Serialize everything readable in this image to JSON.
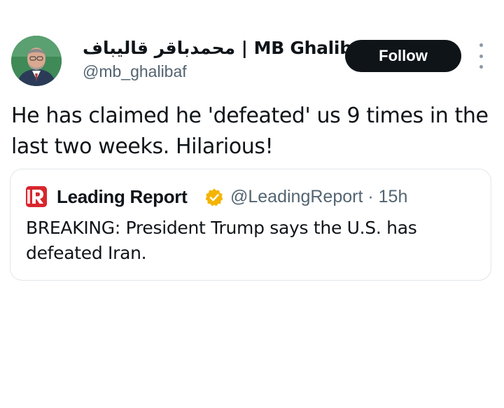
{
  "tweet": {
    "author": {
      "display_name": "محمدباقر قالیباف | MB Ghalib...",
      "handle": "@mb_ghalibaf"
    },
    "follow_label": "Follow",
    "text": "He has claimed he 'defeated' us 9 times in the last two weeks. Hilarious!"
  },
  "quoted_tweet": {
    "author_name": "Leading Report",
    "handle": "@LeadingReport",
    "separator": "·",
    "time": "15h",
    "verified_badge_color": "#f4b400",
    "logo_color": "#d8262e",
    "text": "BREAKING: President Trump says the U.S. has defeated Iran."
  },
  "icons": {
    "more": "more-options-icon",
    "verified": "verified-badge-icon"
  },
  "colors": {
    "text_primary": "#0f1419",
    "text_secondary": "#536471",
    "follow_button": "#0f1419"
  }
}
